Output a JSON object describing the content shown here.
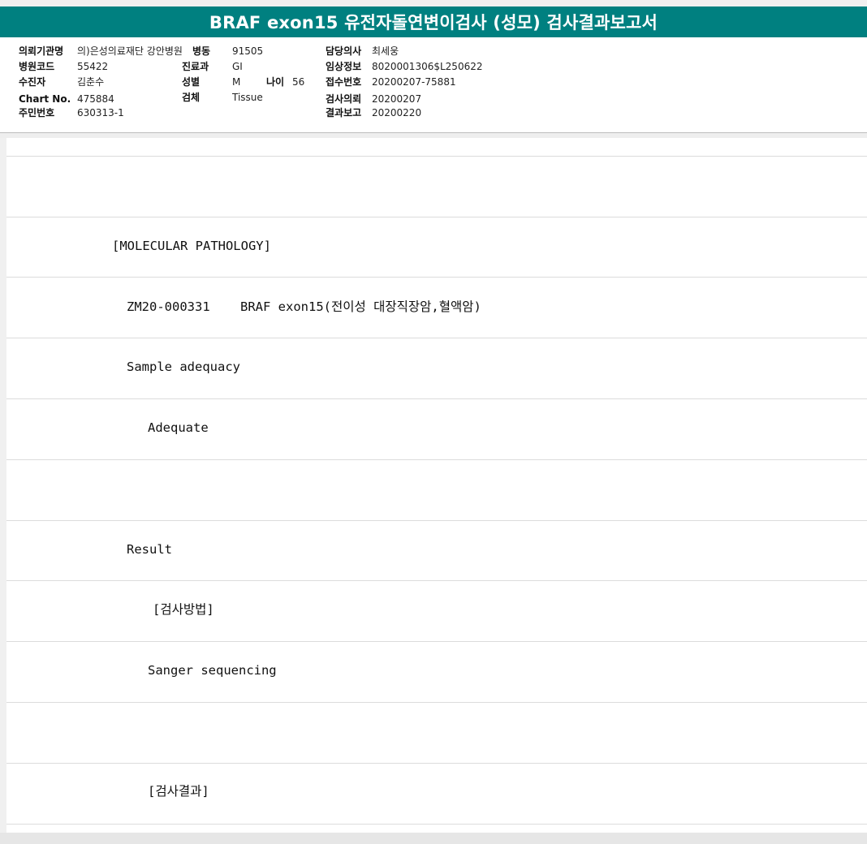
{
  "report": {
    "title": "BRAF exon15 유전자돌연변이검사 (성모) 검사결과보고서"
  },
  "header": {
    "institution_label": "의뢰기관명",
    "institution_value": "의)은성의료재단 강안병원",
    "hospital_code_label": "병원코드",
    "hospital_code_value": "55422",
    "patient_label": "수진자",
    "patient_value": "김춘수",
    "chart_no_label": "Chart No.",
    "chart_no_value": "475884",
    "resident_no_label": "주민번호",
    "resident_no_value": "630313-1",
    "ward_label": "병동",
    "ward_value": "91505",
    "department_label": "진료과",
    "department_value": "GI",
    "sex_label": "성별",
    "sex_value": "M",
    "age_label": "나이",
    "age_value": "56",
    "specimen_label": "검체",
    "specimen_value": "Tissue",
    "doctor_label": "담당의사",
    "doctor_value": "최세웅",
    "clinical_info_label": "임상정보",
    "clinical_info_value": "8020001306$L250622",
    "receipt_no_label": "접수번호",
    "receipt_no_value": "20200207-75881",
    "request_date_label": "검사의뢰",
    "request_date_value": "20200207",
    "report_date_label": "결과보고",
    "report_date_value": "20200220"
  },
  "body": {
    "section": "[MOLECULAR PATHOLOGY]",
    "test_code": "ZM20-000331",
    "test_name": "BRAF exon15(전이성 대장직장암,혈액암)",
    "sample_adequacy_label": "Sample adequacy",
    "sample_adequacy_value": "Adequate",
    "result_label": "Result",
    "method_heading": "[검사방법]",
    "method_value": "Sanger sequencing",
    "result_heading": "[검사결과]"
  }
}
